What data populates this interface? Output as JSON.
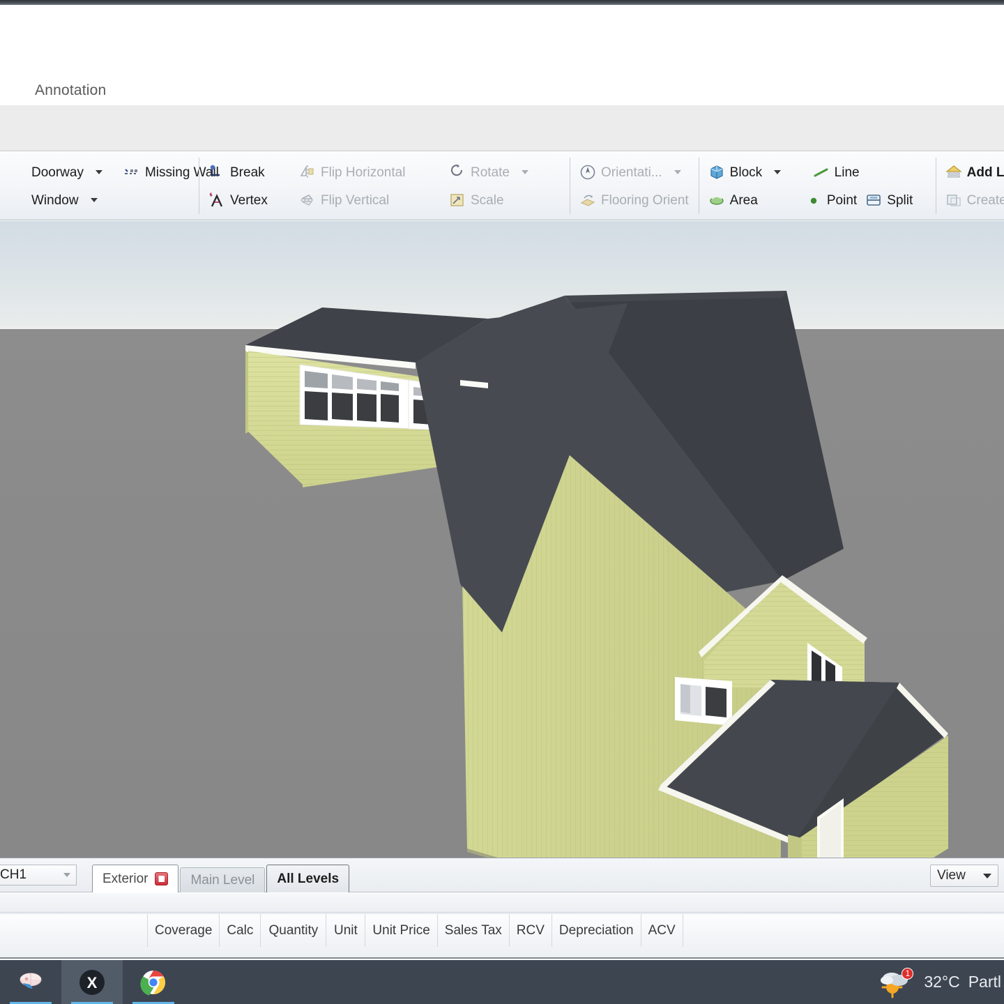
{
  "window": {
    "ribbon_tab": "Annotation"
  },
  "ribbon": {
    "groups": [
      {
        "name": "openings",
        "items": [
          {
            "label": "Doorway",
            "icon": "doorway-icon",
            "dim": false,
            "caret": true
          },
          {
            "label": "Window",
            "icon": "window-icon",
            "dim": false,
            "caret": true
          },
          {
            "label": "Missing Wall",
            "icon": "missing-wall-icon",
            "dim": false,
            "caret": false
          }
        ]
      },
      {
        "name": "edit",
        "items": [
          {
            "label": "Break",
            "icon": "break-icon",
            "dim": false,
            "caret": false
          },
          {
            "label": "Vertex",
            "icon": "vertex-icon",
            "dim": false,
            "caret": false
          },
          {
            "label": "Flip Horizontal",
            "icon": "flip-horizontal-icon",
            "dim": true,
            "caret": false
          },
          {
            "label": "Flip Vertical",
            "icon": "flip-vertical-icon",
            "dim": true,
            "caret": false
          },
          {
            "label": "Rotate",
            "icon": "rotate-icon",
            "dim": true,
            "caret": true
          },
          {
            "label": "Scale",
            "icon": "scale-icon",
            "dim": true,
            "caret": false
          }
        ]
      },
      {
        "name": "orientation",
        "items": [
          {
            "label": "Orientati...",
            "icon": "orientation-icon",
            "dim": true,
            "caret": true
          },
          {
            "label": "Flooring Orient",
            "icon": "flooring-orientation-icon",
            "dim": true,
            "caret": false
          }
        ]
      },
      {
        "name": "shapes",
        "items": [
          {
            "label": "Block",
            "icon": "block-icon",
            "dim": false,
            "caret": true
          },
          {
            "label": "Area",
            "icon": "area-icon",
            "dim": false,
            "caret": false
          },
          {
            "label": "Line",
            "icon": "line-icon",
            "dim": false,
            "caret": false
          },
          {
            "label": "Point",
            "icon": "point-icon",
            "dim": false,
            "caret": false
          },
          {
            "label": "Split",
            "icon": "split-icon",
            "dim": false,
            "caret": false
          }
        ]
      },
      {
        "name": "levels",
        "items": [
          {
            "label": "Add Level Slices",
            "icon": "add-level-slices-icon",
            "dim": false,
            "caret": false
          },
          {
            "label": "Create Levels",
            "icon": "create-levels-icon",
            "dim": true,
            "caret": false
          }
        ]
      }
    ]
  },
  "viewport": {
    "sky_top_color": "#d2dce4",
    "sky_bottom_color": "#f2f2f0",
    "ground_color": "#8a8a8a",
    "siding_color": "#d4d993",
    "roof_color": "#4b4f53",
    "trim_color": "#f5f5f0",
    "model_name": "3d-house-model"
  },
  "bottom_bar": {
    "ch_select_value": "CH1",
    "tabs": [
      {
        "label": "Exterior",
        "state": "active",
        "closable": true
      },
      {
        "label": "Main Level",
        "state": "inactive",
        "closable": false
      },
      {
        "label": "All Levels",
        "state": "selected",
        "closable": false
      }
    ],
    "view_button": "View"
  },
  "grid": {
    "columns": [
      "Coverage",
      "Calc",
      "Quantity",
      "Unit",
      "Unit Price",
      "Sales Tax",
      "RCV",
      "Depreciation",
      "ACV"
    ]
  },
  "taskbar": {
    "apps": [
      {
        "name": "paint-app-icon",
        "state": "open"
      },
      {
        "name": "xactimate-app-icon",
        "state": "active"
      },
      {
        "name": "chrome-app-icon",
        "state": "open"
      }
    ],
    "weather": {
      "temperature": "32°C",
      "condition": "Partl",
      "badge_count": "1",
      "icon": "partly-cloudy-icon"
    }
  }
}
